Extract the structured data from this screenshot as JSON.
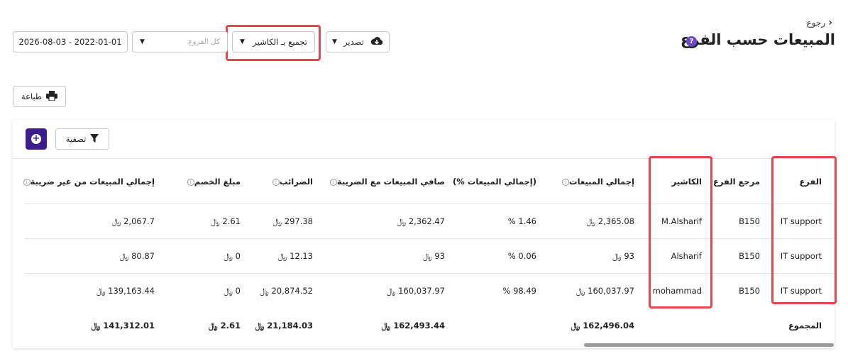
{
  "header": {
    "back_label": "رجوع",
    "title": "المبيعات حسب الفرع",
    "help_icon_glyph": "?"
  },
  "toolbar": {
    "export_label": "تصدير",
    "group_by_label": "تجميع بـ الكاشير",
    "branches_placeholder": "كل الفروع",
    "date_range": "2026-08-03 - 2022-01-01",
    "print_label": "طباعة",
    "filter_label": "تصفية"
  },
  "colors": {
    "accent": "#3b1d8f",
    "help": "#6b48c8",
    "highlight": "#e5464f"
  },
  "table": {
    "columns": {
      "branch": "الفرع",
      "branch_ref": "مرجع الفرع",
      "cashier": "الكاشير",
      "total_sales": "إجمالي المبيعات",
      "sales_pct": "(إجمالي المبيعات %)",
      "net_sales_tax": "صافي المبيعات مع الضريبة",
      "taxes": "الضرائب",
      "discount": "مبلغ الخصم",
      "sales_excl_tax": "إجمالي المبيعات من غير ضريبة"
    },
    "rows": [
      {
        "branch": "IT support",
        "branch_ref": "B150",
        "cashier": "M.Alsharif",
        "total_sales": "2,365.08 ﷼",
        "sales_pct": "1.46 %",
        "net_sales_tax": "2,362.47 ﷼",
        "taxes": "297.38 ﷼",
        "discount": "2.61 ﷼",
        "sales_excl_tax": "2,067.7 ﷼"
      },
      {
        "branch": "IT support",
        "branch_ref": "B150",
        "cashier": "Alsharif",
        "total_sales": "93 ﷼",
        "sales_pct": "0.06 %",
        "net_sales_tax": "93 ﷼",
        "taxes": "12.13 ﷼",
        "discount": "0 ﷼",
        "sales_excl_tax": "80.87 ﷼"
      },
      {
        "branch": "IT support",
        "branch_ref": "B150",
        "cashier": "mohammad",
        "total_sales": "160,037.97 ﷼",
        "sales_pct": "98.49 %",
        "net_sales_tax": "160,037.97 ﷼",
        "taxes": "20,874.52 ﷼",
        "discount": "0 ﷼",
        "sales_excl_tax": "139,163.44 ﷼"
      }
    ],
    "totals": {
      "label": "المجموع",
      "total_sales": "162,496.04 ﷼",
      "net_sales_tax": "162,493.44 ﷼",
      "taxes": "21,184.03 ﷼",
      "discount": "2.61 ﷼",
      "sales_excl_tax": "141,312.01 ﷼"
    }
  }
}
